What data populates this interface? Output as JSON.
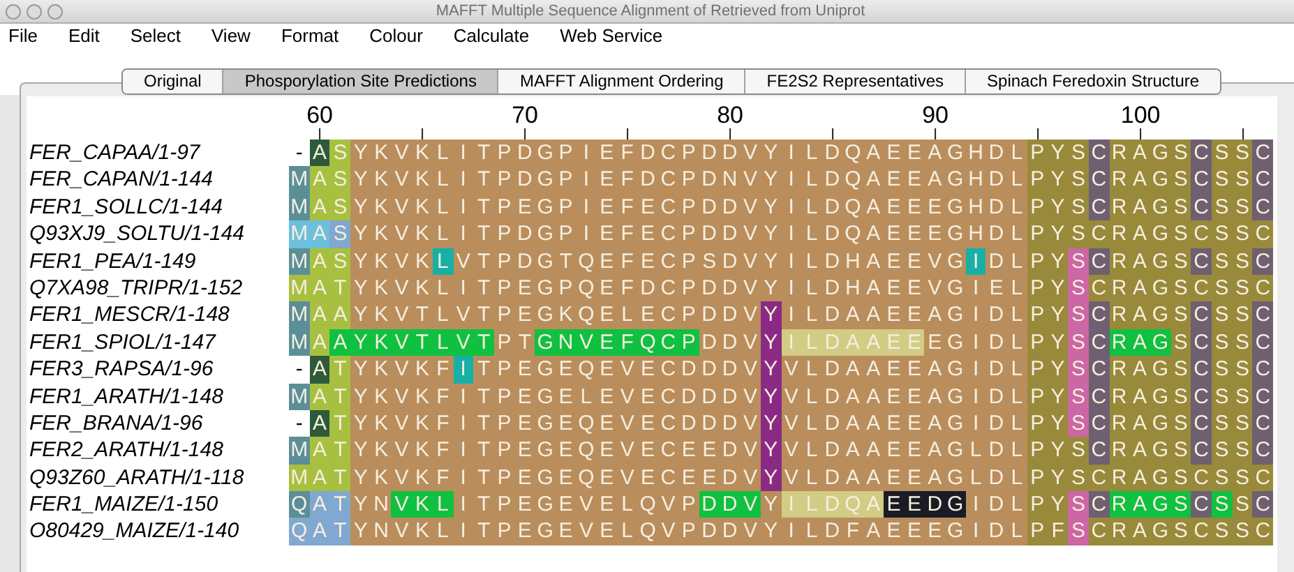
{
  "window": {
    "title": "MAFFT Multiple Sequence Alignment of Retrieved from Uniprot"
  },
  "menu": [
    "File",
    "Edit",
    "Select",
    "View",
    "Format",
    "Colour",
    "Calculate",
    "Web Service"
  ],
  "tabs": [
    {
      "label": "Original",
      "selected": false
    },
    {
      "label": "Phosporylation Site Predictions",
      "selected": true
    },
    {
      "label": "MAFFT Alignment Ordering",
      "selected": false
    },
    {
      "label": "FE2S2 Representatives",
      "selected": false
    },
    {
      "label": "Spinach Feredoxin Structure",
      "selected": false
    }
  ],
  "ruler": [
    "60",
    "70",
    "80",
    "90",
    "100"
  ],
  "sequences": [
    {
      "name": "FER_CAPAA/1-97",
      "residues": [
        {
          "text": "-",
          "color": "#ffffff"
        },
        {
          "text": "A",
          "color": "#2e5a3c"
        },
        {
          "text": "S",
          "color": "#a8c040"
        },
        {
          "text": "Y K V K L I T P D G P I E F D C P D D V Y I L D Q A E E A G H D L",
          "color": "#b98e5c"
        },
        {
          "text": "P Y S",
          "color": "#988a3a"
        },
        {
          "text": "C",
          "color": "#6e6070"
        },
        {
          "text": "R A G S",
          "color": "#988a3a"
        },
        {
          "text": "C",
          "color": "#6e6070"
        },
        {
          "text": "S S",
          "color": "#988a3a"
        },
        {
          "text": "C",
          "color": "#6e6070"
        }
      ]
    },
    {
      "name": "FER_CAPAN/1-144",
      "residues": [
        {
          "text": "M",
          "color": "#5b8f98"
        },
        {
          "text": "A S",
          "color": "#a8c040"
        },
        {
          "text": "Y K V K L I T P D G P I E F D C P D N V Y I L D Q A E E A G H D L",
          "color": "#b98e5c"
        },
        {
          "text": "P Y S",
          "color": "#988a3a"
        },
        {
          "text": "C",
          "color": "#6e6070"
        },
        {
          "text": "R A G S",
          "color": "#988a3a"
        },
        {
          "text": "C",
          "color": "#6e6070"
        },
        {
          "text": "S S",
          "color": "#988a3a"
        },
        {
          "text": "C",
          "color": "#6e6070"
        }
      ]
    },
    {
      "name": "FER1_SOLLC/1-144",
      "residues": [
        {
          "text": "M",
          "color": "#5b8f98"
        },
        {
          "text": "A S",
          "color": "#a8c040"
        },
        {
          "text": "Y K V K L I T P E G P I E F E C P D D V Y I L D Q A E E E G H D L",
          "color": "#b98e5c"
        },
        {
          "text": "P Y S",
          "color": "#988a3a"
        },
        {
          "text": "C",
          "color": "#6e6070"
        },
        {
          "text": "R A G S",
          "color": "#988a3a"
        },
        {
          "text": "C",
          "color": "#6e6070"
        },
        {
          "text": "S S",
          "color": "#988a3a"
        },
        {
          "text": "C",
          "color": "#6e6070"
        }
      ]
    },
    {
      "name": "Q93XJ9_SOLTU/1-144",
      "residues": [
        {
          "text": "M A",
          "color": "#6cc0dc"
        },
        {
          "text": "S",
          "color": "#80a8d0"
        },
        {
          "text": "Y K V K L I T P D G P I E F E C P D D V Y I L D Q A E E E G H D L",
          "color": "#b98e5c"
        },
        {
          "text": "P Y S C R A G S C S S C",
          "color": "#988a3a"
        }
      ]
    },
    {
      "name": "FER1_PEA/1-149",
      "residues": [
        {
          "text": "M",
          "color": "#5b8f98"
        },
        {
          "text": "A S",
          "color": "#a8c040"
        },
        {
          "text": "Y K V K",
          "color": "#b98e5c"
        },
        {
          "text": "L",
          "color": "#16b0a4"
        },
        {
          "text": "V T P D G T Q E F E C P S D V Y I L D H A E E V G",
          "color": "#b98e5c"
        },
        {
          "text": "I",
          "color": "#16b0a4"
        },
        {
          "text": "D L",
          "color": "#b98e5c"
        },
        {
          "text": "P Y",
          "color": "#988a3a"
        },
        {
          "text": "S",
          "color": "#cc66a4"
        },
        {
          "text": "C",
          "color": "#6e6070"
        },
        {
          "text": "R A G S",
          "color": "#988a3a"
        },
        {
          "text": "C",
          "color": "#6e6070"
        },
        {
          "text": "S S",
          "color": "#988a3a"
        },
        {
          "text": "C",
          "color": "#6e6070"
        }
      ]
    },
    {
      "name": "Q7XA98_TRIPR/1-152",
      "residues": [
        {
          "text": "M A T",
          "color": "#a8c040"
        },
        {
          "text": "Y K V K L I T P E G P Q E F D C P D D V Y I L D H A E E V G I E L",
          "color": "#b98e5c"
        },
        {
          "text": "P Y",
          "color": "#988a3a"
        },
        {
          "text": "S",
          "color": "#cc66a4"
        },
        {
          "text": "C R A G S C S S C",
          "color": "#988a3a"
        }
      ]
    },
    {
      "name": "FER1_MESCR/1-148",
      "residues": [
        {
          "text": "M",
          "color": "#5b8f98"
        },
        {
          "text": "A A",
          "color": "#a8c040"
        },
        {
          "text": "Y K V T L V T P E G K Q E L E C P D D V",
          "color": "#b98e5c"
        },
        {
          "text": "Y",
          "color": "#8b2a84"
        },
        {
          "text": "I L D A A E E A G I D L",
          "color": "#b98e5c"
        },
        {
          "text": "P Y",
          "color": "#988a3a"
        },
        {
          "text": "S",
          "color": "#cc66a4"
        },
        {
          "text": "C",
          "color": "#6e6070"
        },
        {
          "text": "R A G S",
          "color": "#988a3a"
        },
        {
          "text": "C",
          "color": "#6e6070"
        },
        {
          "text": "S S",
          "color": "#988a3a"
        },
        {
          "text": "C",
          "color": "#6e6070"
        }
      ]
    },
    {
      "name": "FER1_SPIOL/1-147",
      "residues": [
        {
          "text": "M",
          "color": "#5b8f98"
        },
        {
          "text": "A",
          "color": "#a8c040"
        },
        {
          "text": "A Y K V T L V T",
          "color": "#10c040"
        },
        {
          "text": "P T",
          "color": "#b98e5c"
        },
        {
          "text": "G N V E F Q C P",
          "color": "#10c040"
        },
        {
          "text": "D D V",
          "color": "#b98e5c"
        },
        {
          "text": "Y",
          "color": "#8b2a84"
        },
        {
          "text": "I L D A A E E",
          "color": "#d2cc84"
        },
        {
          "text": "E G I D L",
          "color": "#b98e5c"
        },
        {
          "text": "P Y",
          "color": "#988a3a"
        },
        {
          "text": "S",
          "color": "#cc66a4"
        },
        {
          "text": "C",
          "color": "#6e6070"
        },
        {
          "text": "R A G",
          "color": "#10c040"
        },
        {
          "text": "S",
          "color": "#988a3a"
        },
        {
          "text": "C",
          "color": "#6e6070"
        },
        {
          "text": "S S",
          "color": "#988a3a"
        },
        {
          "text": "C",
          "color": "#6e6070"
        }
      ]
    },
    {
      "name": "FER3_RAPSA/1-96",
      "residues": [
        {
          "text": "-",
          "color": "#ffffff"
        },
        {
          "text": "A",
          "color": "#2e5a3c"
        },
        {
          "text": "T",
          "color": "#a8c040"
        },
        {
          "text": "Y K V K F",
          "color": "#b98e5c"
        },
        {
          "text": "I",
          "color": "#16b0a4"
        },
        {
          "text": "T P E G E Q E V E C D D D V",
          "color": "#b98e5c"
        },
        {
          "text": "Y",
          "color": "#8b2a84"
        },
        {
          "text": "V L D A A E E A G I D L",
          "color": "#b98e5c"
        },
        {
          "text": "P Y",
          "color": "#988a3a"
        },
        {
          "text": "S",
          "color": "#cc66a4"
        },
        {
          "text": "C",
          "color": "#6e6070"
        },
        {
          "text": "R A G S",
          "color": "#988a3a"
        },
        {
          "text": "C",
          "color": "#6e6070"
        },
        {
          "text": "S S",
          "color": "#988a3a"
        },
        {
          "text": "C",
          "color": "#6e6070"
        }
      ]
    },
    {
      "name": "FER1_ARATH/1-148",
      "residues": [
        {
          "text": "M",
          "color": "#5b8f98"
        },
        {
          "text": "A T",
          "color": "#a8c040"
        },
        {
          "text": "Y K V K F I T P E G E L E V E C D D D V",
          "color": "#b98e5c"
        },
        {
          "text": "Y",
          "color": "#8b2a84"
        },
        {
          "text": "V L D A A E E A G I D L",
          "color": "#b98e5c"
        },
        {
          "text": "P Y",
          "color": "#988a3a"
        },
        {
          "text": "S",
          "color": "#cc66a4"
        },
        {
          "text": "C",
          "color": "#6e6070"
        },
        {
          "text": "R A G S",
          "color": "#988a3a"
        },
        {
          "text": "C",
          "color": "#6e6070"
        },
        {
          "text": "S S",
          "color": "#988a3a"
        },
        {
          "text": "C",
          "color": "#6e6070"
        }
      ]
    },
    {
      "name": "FER_BRANA/1-96",
      "residues": [
        {
          "text": "-",
          "color": "#ffffff"
        },
        {
          "text": "A",
          "color": "#2e5a3c"
        },
        {
          "text": "T",
          "color": "#a8c040"
        },
        {
          "text": "Y K V K F I T P E G E Q E V E C D D D V",
          "color": "#b98e5c"
        },
        {
          "text": "Y",
          "color": "#8b2a84"
        },
        {
          "text": "V L D A A E E A G I D L",
          "color": "#b98e5c"
        },
        {
          "text": "P Y",
          "color": "#988a3a"
        },
        {
          "text": "S",
          "color": "#cc66a4"
        },
        {
          "text": "C",
          "color": "#6e6070"
        },
        {
          "text": "R A G S",
          "color": "#988a3a"
        },
        {
          "text": "C",
          "color": "#6e6070"
        },
        {
          "text": "S S",
          "color": "#988a3a"
        },
        {
          "text": "C",
          "color": "#6e6070"
        }
      ]
    },
    {
      "name": "FER2_ARATH/1-148",
      "residues": [
        {
          "text": "M",
          "color": "#5b8f98"
        },
        {
          "text": "A T",
          "color": "#a8c040"
        },
        {
          "text": "Y K V K F I T P E G E Q E V E C E E D V",
          "color": "#b98e5c"
        },
        {
          "text": "Y",
          "color": "#8b2a84"
        },
        {
          "text": "V L D A A E E A G L D L",
          "color": "#b98e5c"
        },
        {
          "text": "P Y S",
          "color": "#988a3a"
        },
        {
          "text": "C",
          "color": "#6e6070"
        },
        {
          "text": "R A G S",
          "color": "#988a3a"
        },
        {
          "text": "C",
          "color": "#6e6070"
        },
        {
          "text": "S S",
          "color": "#988a3a"
        },
        {
          "text": "C",
          "color": "#6e6070"
        }
      ]
    },
    {
      "name": "Q93Z60_ARATH/1-118",
      "residues": [
        {
          "text": "M A T",
          "color": "#a8c040"
        },
        {
          "text": "Y K V K F I T P E G E Q E V E C E E D V",
          "color": "#b98e5c"
        },
        {
          "text": "Y",
          "color": "#8b2a84"
        },
        {
          "text": "V L D A A E E A G L D L",
          "color": "#b98e5c"
        },
        {
          "text": "P Y S C R A G S C S S C",
          "color": "#988a3a"
        }
      ]
    },
    {
      "name": "FER1_MAIZE/1-150",
      "residues": [
        {
          "text": "Q",
          "color": "#5b8f98"
        },
        {
          "text": "A T",
          "color": "#80a8d0"
        },
        {
          "text": "Y N",
          "color": "#b98e5c"
        },
        {
          "text": "V K L",
          "color": "#10c040"
        },
        {
          "text": "I T P E G E V E L Q V P",
          "color": "#b98e5c"
        },
        {
          "text": "D D V",
          "color": "#10c040"
        },
        {
          "text": "Y",
          "color": "#b98e5c"
        },
        {
          "text": "I L D Q A",
          "color": "#d2cc84"
        },
        {
          "text": "E E D G",
          "color": "#1b1b26"
        },
        {
          "text": "I D L",
          "color": "#b98e5c"
        },
        {
          "text": "P Y",
          "color": "#988a3a"
        },
        {
          "text": "S",
          "color": "#cc66a4"
        },
        {
          "text": "C",
          "color": "#6e6070"
        },
        {
          "text": "R A G S",
          "color": "#10c040"
        },
        {
          "text": "C",
          "color": "#6e6070"
        },
        {
          "text": "S",
          "color": "#10c040"
        },
        {
          "text": "S",
          "color": "#988a3a"
        },
        {
          "text": "C",
          "color": "#6e6070"
        }
      ]
    },
    {
      "name": "O80429_MAIZE/1-140",
      "residues": [
        {
          "text": "Q A T",
          "color": "#80a8d0"
        },
        {
          "text": "Y N V K L I T P E G E V E L Q V P D D V Y I L D F A E E E G I D L",
          "color": "#b98e5c"
        },
        {
          "text": "P F",
          "color": "#988a3a"
        },
        {
          "text": "S",
          "color": "#cc66a4"
        },
        {
          "text": "C R A G S C S S C",
          "color": "#988a3a"
        }
      ]
    }
  ]
}
